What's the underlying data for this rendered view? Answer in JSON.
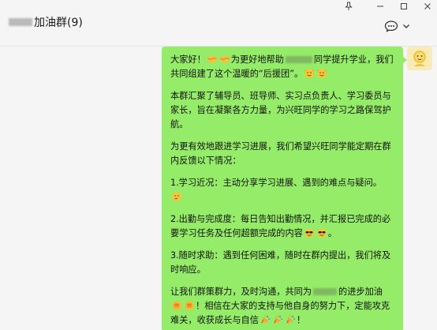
{
  "window": {
    "title": "加油群(9)"
  },
  "message": {
    "lines": [
      {
        "pre": "大家好！",
        "emoji_after_pre": [
          "handshake",
          "handshake"
        ],
        "mid": "为更好地帮助",
        "blur": true,
        "post": "同学提升学业，我们"
      },
      {
        "pre": "共同组建了这个温暖的“后援团”。",
        "emoji_after_pre": [
          "proud",
          "proud"
        ]
      },
      {
        "gap": true
      },
      {
        "pre": "本群汇聚了辅导员、班导师、实习点负责人、学习委员与"
      },
      {
        "pre": "家长，旨在凝聚各方力量，为兴旺同学的学习之路保驾护"
      },
      {
        "pre": "航。"
      },
      {
        "gap": true
      },
      {
        "pre": "为更有效地跟进学习进展，我们希望兴旺同学能定期在群"
      },
      {
        "pre": "内反馈以下情况："
      },
      {
        "gap": true
      },
      {
        "pre": "1.学习近况：主动分享学习进展、遇到的难点与疑问。"
      },
      {
        "emoji_only": [
          "thinking"
        ]
      },
      {
        "gap": true
      },
      {
        "pre": "2.出勤与完成度：每日告知出勤情况，并汇报已完成的必"
      },
      {
        "pre": "要学习任务及任何超额完成的内容",
        "emoji_after_pre": [
          "cool",
          "cool"
        ],
        "tail": "。"
      },
      {
        "gap": true
      },
      {
        "pre": "3.随时求助：遇到任何困难，随时在群内提出，我们将及"
      },
      {
        "pre": "时响应。"
      },
      {
        "gap": true
      },
      {
        "pre": "让我们群策群力，及时沟通，共同为",
        "blur": true,
        "post": "的进步加油"
      },
      {
        "emoji_only_pre": [
          "fist",
          "fist"
        ],
        "post": "！相信在大家的支持与他自身的努力下，定能攻克"
      },
      {
        "pre": "难关，收获成长与自信",
        "emoji_after_pre": [
          "party",
          "party",
          "party"
        ],
        "tail": "！"
      }
    ]
  },
  "icons": {
    "pin": "pin-icon",
    "minimize": "minimize-icon",
    "maximize": "maximize-icon",
    "close": "close-icon",
    "chat": "chat-bubble-icon",
    "more": "chevron-down-icon"
  },
  "colors": {
    "bubble": "#95ec69",
    "background": "#f5f5f5"
  }
}
